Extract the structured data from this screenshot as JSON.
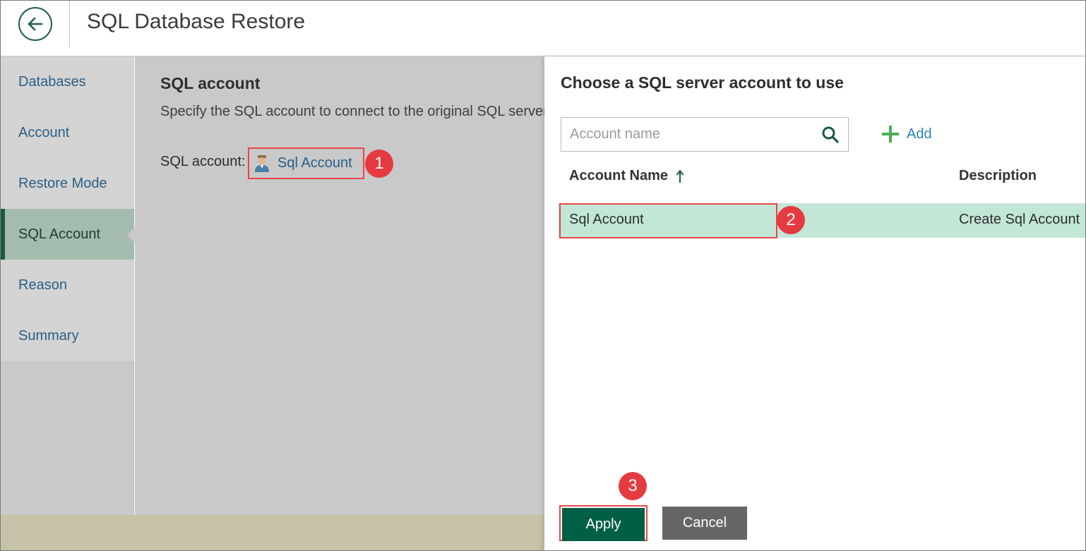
{
  "header": {
    "title": "SQL Database Restore",
    "back_icon": "back-arrow-icon"
  },
  "sidebar": {
    "items": [
      {
        "label": "Databases"
      },
      {
        "label": "Account"
      },
      {
        "label": "Restore Mode"
      },
      {
        "label": "SQL Account",
        "active": true
      },
      {
        "label": "Reason"
      },
      {
        "label": "Summary"
      }
    ]
  },
  "main": {
    "section_title": "SQL account",
    "description": "Specify the SQL account to connect to the original SQL server",
    "field_label": "SQL account:",
    "account_link": "Sql Account",
    "account_icon": "user-icon"
  },
  "panel": {
    "title": "Choose a SQL server account to use",
    "search": {
      "placeholder": "Account name",
      "value": "",
      "icon": "search-icon"
    },
    "add_label": "Add",
    "add_icon": "plus-icon",
    "columns": [
      {
        "label": "Account Name",
        "sort": "ascending"
      },
      {
        "label": "Description"
      }
    ],
    "rows": [
      {
        "account_name": "Sql Account",
        "description": "Create Sql Account",
        "selected": true
      }
    ],
    "apply_label": "Apply",
    "cancel_label": "Cancel"
  },
  "annotations": {
    "step1": "1",
    "step2": "2",
    "step3": "3"
  },
  "colors": {
    "accent": "#005f44",
    "selected_row": "#c2e7d6",
    "link": "#255e8a",
    "annotation": "#e53a3f"
  }
}
